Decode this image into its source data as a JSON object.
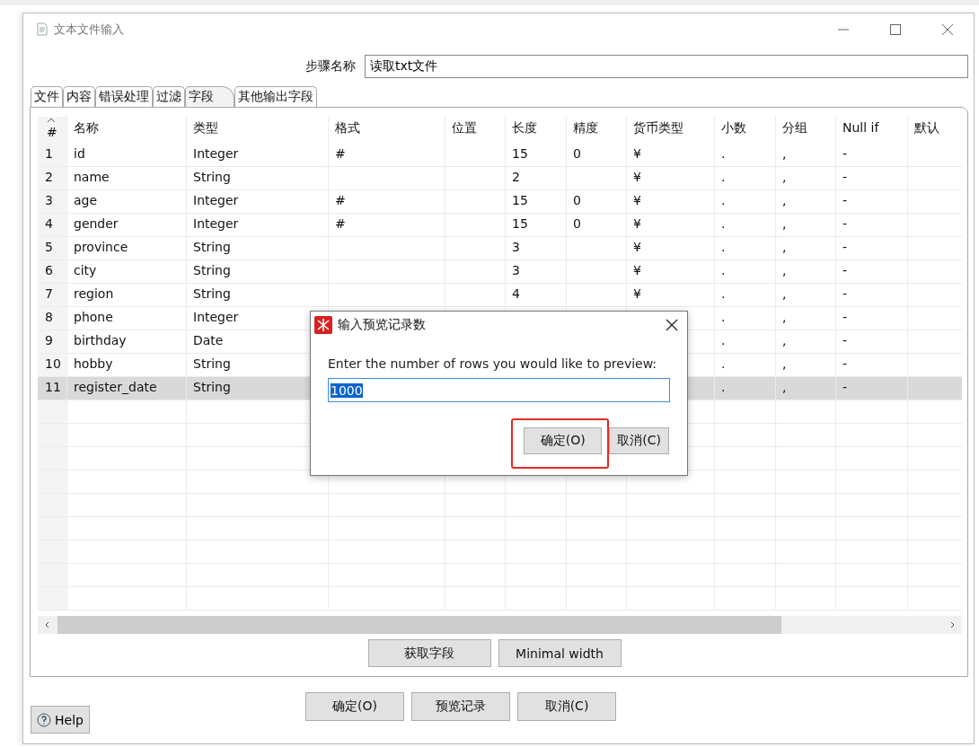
{
  "window": {
    "title": "文本文件输入"
  },
  "step_name": {
    "label": "步骤名称",
    "value": "读取txt文件"
  },
  "tabs": [
    {
      "label": "文件",
      "selected": false
    },
    {
      "label": "内容",
      "selected": false
    },
    {
      "label": "错误处理",
      "selected": false
    },
    {
      "label": "过滤",
      "selected": false
    },
    {
      "label": "字段",
      "selected": true
    },
    {
      "label": "其他输出字段",
      "selected": false
    }
  ],
  "table": {
    "columns": [
      "#",
      "名称",
      "类型",
      "格式",
      "位置",
      "长度",
      "精度",
      "货币类型",
      "小数",
      "分组",
      "Null if",
      "默认"
    ],
    "rows": [
      {
        "num": "1",
        "name": "id",
        "type": "Integer",
        "format": "#",
        "length": "15",
        "precision": "0",
        "currency": "¥",
        "decimal": ".",
        "group": ",",
        "null_if": "-",
        "selected": false
      },
      {
        "num": "2",
        "name": "name",
        "type": "String",
        "length": "2",
        "currency": "¥",
        "decimal": ".",
        "group": ",",
        "null_if": "-",
        "selected": false
      },
      {
        "num": "3",
        "name": "age",
        "type": "Integer",
        "format": "#",
        "length": "15",
        "precision": "0",
        "currency": "¥",
        "decimal": ".",
        "group": ",",
        "null_if": "-",
        "selected": false
      },
      {
        "num": "4",
        "name": "gender",
        "type": "Integer",
        "format": "#",
        "length": "15",
        "precision": "0",
        "currency": "¥",
        "decimal": ".",
        "group": ",",
        "null_if": "-",
        "selected": false
      },
      {
        "num": "5",
        "name": "province",
        "type": "String",
        "length": "3",
        "currency": "¥",
        "decimal": ".",
        "group": ",",
        "null_if": "-",
        "selected": false
      },
      {
        "num": "6",
        "name": "city",
        "type": "String",
        "length": "3",
        "currency": "¥",
        "decimal": ".",
        "group": ",",
        "null_if": "-",
        "selected": false
      },
      {
        "num": "7",
        "name": "region",
        "type": "String",
        "length": "4",
        "currency": "¥",
        "decimal": ".",
        "group": ",",
        "null_if": "-",
        "selected": false
      },
      {
        "num": "8",
        "name": "phone",
        "type": "Integer",
        "decimal": ".",
        "group": ",",
        "null_if": "-",
        "selected": false
      },
      {
        "num": "9",
        "name": "birthday",
        "type": "Date",
        "decimal": ".",
        "group": ",",
        "null_if": "-",
        "selected": false
      },
      {
        "num": "10",
        "name": "hobby",
        "type": "String",
        "decimal": ".",
        "group": ",",
        "null_if": "-",
        "selected": false
      },
      {
        "num": "11",
        "name": "register_date",
        "type": "String",
        "decimal": ".",
        "group": ",",
        "null_if": "-",
        "selected": true
      }
    ]
  },
  "table_buttons": [
    "获取字段",
    "Minimal width"
  ],
  "buttons": [
    "确定(O)",
    "预览记录",
    "取消(C)"
  ],
  "help": "Help",
  "dialog": {
    "title": "输入预览记录数",
    "prompt": "Enter the number of rows you would like to preview:",
    "value": "1000",
    "buttons": [
      {
        "label": "确定(O)",
        "highlighted": true
      },
      {
        "label": "取消(C)",
        "highlighted": false
      }
    ]
  }
}
